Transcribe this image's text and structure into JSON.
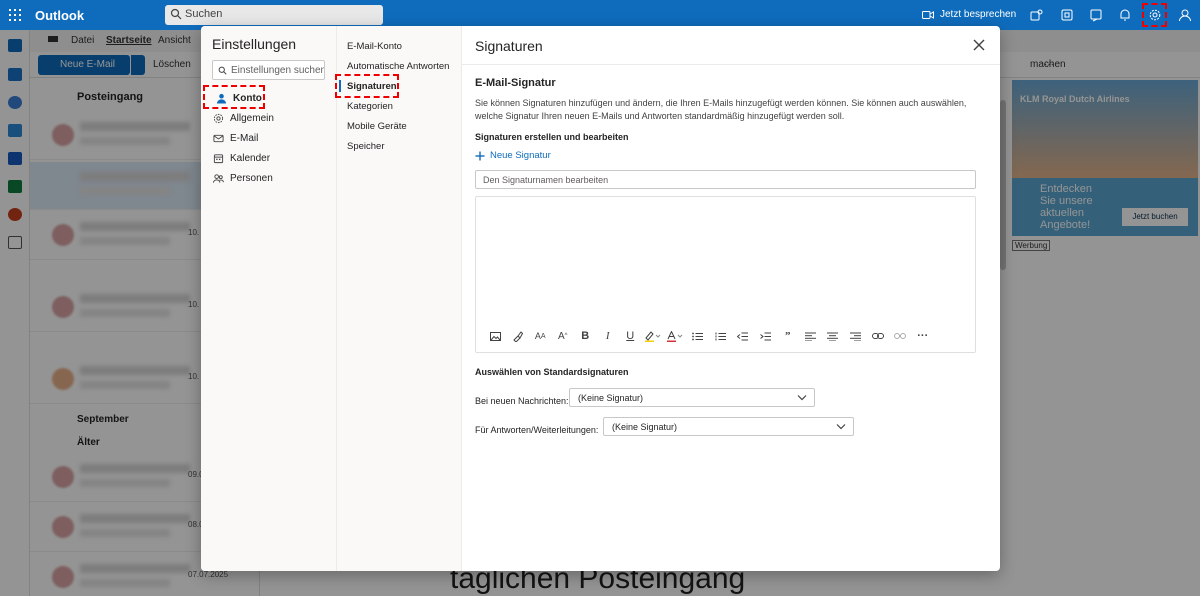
{
  "app": {
    "title": "Outlook"
  },
  "topbar": {
    "search_placeholder": "Suchen",
    "meet_now": "Jetzt besprechen"
  },
  "ribbon": {
    "tabs": [
      "Datei",
      "Startseite",
      "Ansicht"
    ],
    "new_mail": "Neue E-Mail",
    "delete": "Löschen",
    "make_partial": "machen",
    "more": "···"
  },
  "maillist": {
    "title": "Posteingang",
    "sections": [
      "September",
      "Älter"
    ],
    "dates": [
      "10.",
      "10.",
      "10.",
      "09.0",
      "08.0",
      "07.07.2025"
    ]
  },
  "reading_pane": {
    "visible_text": "täglichen Posteingang"
  },
  "ad": {
    "brand": "KLM  Royal Dutch Airlines",
    "tagline": "Entdecken Sie unsere aktuellen Angebote!",
    "cta": "Jetzt buchen",
    "label": "Werbung"
  },
  "settings": {
    "title": "Einstellungen",
    "search_placeholder": "Einstellungen suchen",
    "categories": [
      {
        "label": "Konto",
        "icon": "person-icon",
        "selected": true
      },
      {
        "label": "Allgemein",
        "icon": "gear-icon",
        "selected": false
      },
      {
        "label": "E-Mail",
        "icon": "mail-icon",
        "selected": false
      },
      {
        "label": "Kalender",
        "icon": "calendar-icon",
        "selected": false
      },
      {
        "label": "Personen",
        "icon": "people-icon",
        "selected": false
      }
    ],
    "subcategories": [
      {
        "label": "E-Mail-Konto",
        "selected": false
      },
      {
        "label": "Automatische Antworten",
        "selected": false
      },
      {
        "label": "Signaturen",
        "selected": true
      },
      {
        "label": "Kategorien",
        "selected": false
      },
      {
        "label": "Mobile Geräte",
        "selected": false
      },
      {
        "label": "Speicher",
        "selected": false
      }
    ],
    "page": {
      "title": "Signaturen",
      "section_title": "E-Mail-Signatur",
      "description": "Sie können Signaturen hinzufügen und ändern, die Ihren E-Mails hinzugefügt werden können. Sie können auch auswählen, welche Signatur Ihren neuen E-Mails und Antworten standardmäßig hinzugefügt werden soll.",
      "create_edit_label": "Signaturen erstellen und bearbeiten",
      "new_signature": "Neue Signatur",
      "name_placeholder": "Den Signaturnamen bearbeiten",
      "toolbar": [
        "image-icon",
        "format-painter-icon",
        "font-size-decrease-icon",
        "font-size-increase-icon",
        "bold-icon",
        "italic-icon",
        "underline-icon",
        "highlight-icon",
        "font-color-icon",
        "bullets-icon",
        "numbering-icon",
        "outdent-icon",
        "indent-icon",
        "quote-icon",
        "align-left-icon",
        "align-center-icon",
        "align-right-icon",
        "link-icon",
        "unlink-icon",
        "more-options-icon"
      ],
      "defaults_title": "Auswählen von Standardsignaturen",
      "new_messages_label": "Bei neuen Nachrichten:",
      "new_messages_value": "(Keine Signatur)",
      "replies_label": "Für Antworten/Weiterleitungen:",
      "replies_value": "(Keine Signatur)"
    }
  },
  "colors": {
    "brand": "#0f6cbd",
    "highlight": "#e00000"
  }
}
